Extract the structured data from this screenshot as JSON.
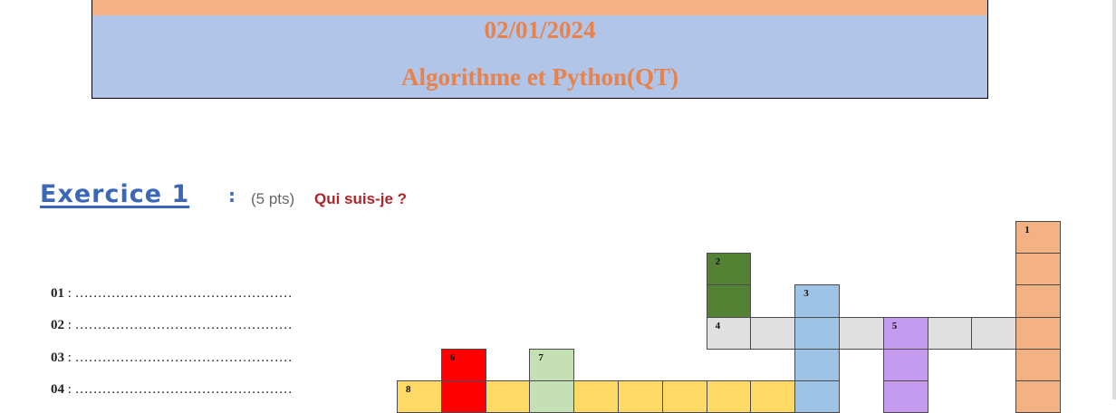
{
  "header": {
    "date": "02/01/2024",
    "subject": "Algorithme et Python(QT)",
    "colors": {
      "strip": "#f4b183",
      "band": "#b0c5e8",
      "text": "#e9824a"
    }
  },
  "exercise": {
    "title": "Exercice 1",
    "colon": ":",
    "points": "(5 pts)",
    "question": "Qui suis-je ?"
  },
  "answers": [
    {
      "num": "01",
      "sep": " : ",
      "dots": "…………………………………………"
    },
    {
      "num": "02",
      "sep": " : ",
      "dots": "…………………………………………"
    },
    {
      "num": "03",
      "sep": " : ",
      "dots": "…………………………………………"
    },
    {
      "num": "04",
      "sep": " : ",
      "dots": "…………………………………………"
    }
  ],
  "crossword": {
    "clue_numbers": [
      "1",
      "2",
      "3",
      "4",
      "5",
      "6",
      "7",
      "8"
    ],
    "colors": {
      "w1": "#f4b183",
      "w2": "#548235",
      "w3": "#9dc3e6",
      "w4": "#e0e0e0",
      "w5": "#c59bf0",
      "w6": "#ff0000",
      "w7": "#c5e0b4",
      "w8": "#ffd966"
    }
  }
}
